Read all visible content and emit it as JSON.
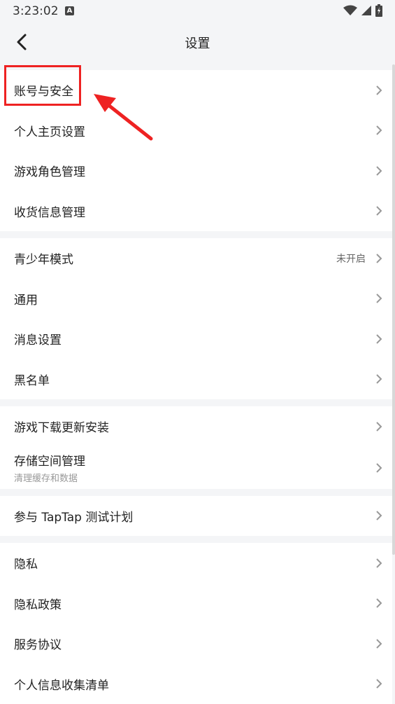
{
  "status_bar": {
    "time": "3:23:02",
    "notification_letter": "A"
  },
  "header": {
    "title": "设置"
  },
  "groups": [
    {
      "items": [
        {
          "label": "账号与安全"
        },
        {
          "label": "个人主页设置"
        },
        {
          "label": "游戏角色管理"
        },
        {
          "label": "收货信息管理"
        }
      ]
    },
    {
      "items": [
        {
          "label": "青少年模式",
          "value": "未开启"
        },
        {
          "label": "通用"
        },
        {
          "label": "消息设置"
        },
        {
          "label": "黑名单"
        }
      ]
    },
    {
      "items": [
        {
          "label": "游戏下载更新安装"
        },
        {
          "label": "存储空间管理",
          "sub": "清理缓存和数据"
        }
      ]
    },
    {
      "items": [
        {
          "label": "参与 TapTap 测试计划"
        }
      ]
    },
    {
      "items": [
        {
          "label": "隐私"
        },
        {
          "label": "隐私政策"
        },
        {
          "label": "服务协议"
        },
        {
          "label": "个人信息收集清单"
        }
      ]
    }
  ],
  "colors": {
    "annotation": "#ee2222",
    "chevron": "#999999"
  }
}
